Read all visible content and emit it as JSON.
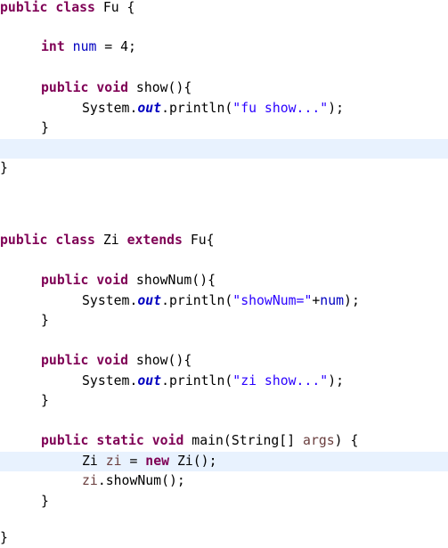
{
  "editor": {
    "language": "Java",
    "highlight_color": "#e8f2fe",
    "colors": {
      "keyword": "#7f0055",
      "field": "#0000c0",
      "string": "#2a00ff",
      "local_variable": "#6a3e3e",
      "plain": "#000000"
    },
    "lines": [
      {
        "indent": 0,
        "highlighted": false,
        "tokens": [
          {
            "t": "kw",
            "v": "public"
          },
          {
            "t": "p",
            "v": " "
          },
          {
            "t": "kw",
            "v": "class"
          },
          {
            "t": "p",
            "v": " Fu {"
          }
        ]
      },
      {
        "indent": 1,
        "highlighted": false,
        "tokens": [
          {
            "t": "kw",
            "v": "int"
          },
          {
            "t": "p",
            "v": " "
          },
          {
            "t": "field",
            "v": "num"
          },
          {
            "t": "p",
            "v": " = 4;"
          }
        ]
      },
      {
        "indent": 1,
        "highlighted": false,
        "tokens": [
          {
            "t": "kw",
            "v": "public"
          },
          {
            "t": "p",
            "v": " "
          },
          {
            "t": "kw",
            "v": "void"
          },
          {
            "t": "p",
            "v": " show(){"
          }
        ]
      },
      {
        "indent": 2,
        "highlighted": false,
        "tokens": [
          {
            "t": "p",
            "v": "System."
          },
          {
            "t": "sfield",
            "v": "out"
          },
          {
            "t": "p",
            "v": ".println("
          },
          {
            "t": "str",
            "v": "\"fu show...\""
          },
          {
            "t": "p",
            "v": ");"
          }
        ]
      },
      {
        "indent": 1,
        "highlighted": false,
        "tokens": [
          {
            "t": "p",
            "v": "}"
          }
        ]
      },
      {
        "indent": 0,
        "highlighted": true,
        "tokens": []
      },
      {
        "indent": 0,
        "highlighted": false,
        "tokens": [
          {
            "t": "p",
            "v": "}"
          }
        ]
      },
      {
        "indent": 0,
        "highlighted": false,
        "tokens": [
          {
            "t": "kw",
            "v": "public"
          },
          {
            "t": "p",
            "v": " "
          },
          {
            "t": "kw",
            "v": "class"
          },
          {
            "t": "p",
            "v": " Zi "
          },
          {
            "t": "kw",
            "v": "extends"
          },
          {
            "t": "p",
            "v": " Fu{"
          }
        ]
      },
      {
        "indent": 1,
        "highlighted": false,
        "tokens": [
          {
            "t": "kw",
            "v": "public"
          },
          {
            "t": "p",
            "v": " "
          },
          {
            "t": "kw",
            "v": "void"
          },
          {
            "t": "p",
            "v": " showNum(){"
          }
        ]
      },
      {
        "indent": 2,
        "highlighted": false,
        "tokens": [
          {
            "t": "p",
            "v": "System."
          },
          {
            "t": "sfield",
            "v": "out"
          },
          {
            "t": "p",
            "v": ".println("
          },
          {
            "t": "str",
            "v": "\"showNum=\""
          },
          {
            "t": "p",
            "v": "+"
          },
          {
            "t": "field",
            "v": "num"
          },
          {
            "t": "p",
            "v": ");"
          }
        ]
      },
      {
        "indent": 1,
        "highlighted": false,
        "tokens": [
          {
            "t": "p",
            "v": "}"
          }
        ]
      },
      {
        "indent": 1,
        "highlighted": false,
        "tokens": [
          {
            "t": "kw",
            "v": "public"
          },
          {
            "t": "p",
            "v": " "
          },
          {
            "t": "kw",
            "v": "void"
          },
          {
            "t": "p",
            "v": " show(){"
          }
        ]
      },
      {
        "indent": 2,
        "highlighted": false,
        "tokens": [
          {
            "t": "p",
            "v": "System."
          },
          {
            "t": "sfield",
            "v": "out"
          },
          {
            "t": "p",
            "v": ".println("
          },
          {
            "t": "str",
            "v": "\"zi show...\""
          },
          {
            "t": "p",
            "v": ");"
          }
        ]
      },
      {
        "indent": 1,
        "highlighted": false,
        "tokens": [
          {
            "t": "p",
            "v": "}"
          }
        ]
      },
      {
        "indent": 1,
        "highlighted": false,
        "tokens": [
          {
            "t": "kw",
            "v": "public"
          },
          {
            "t": "p",
            "v": " "
          },
          {
            "t": "kw",
            "v": "static"
          },
          {
            "t": "p",
            "v": " "
          },
          {
            "t": "kw",
            "v": "void"
          },
          {
            "t": "p",
            "v": " main(String[] "
          },
          {
            "t": "local",
            "v": "args"
          },
          {
            "t": "p",
            "v": ") {"
          }
        ]
      },
      {
        "indent": 2,
        "highlighted": true,
        "tokens": [
          {
            "t": "p",
            "v": "Zi "
          },
          {
            "t": "local",
            "v": "zi"
          },
          {
            "t": "p",
            "v": " = "
          },
          {
            "t": "kw",
            "v": "new"
          },
          {
            "t": "p",
            "v": " Zi();"
          }
        ]
      },
      {
        "indent": 2,
        "highlighted": false,
        "tokens": [
          {
            "t": "local",
            "v": "zi"
          },
          {
            "t": "p",
            "v": ".showNum();"
          }
        ]
      },
      {
        "indent": 1,
        "highlighted": false,
        "tokens": [
          {
            "t": "p",
            "v": "}"
          }
        ]
      },
      {
        "indent": 0,
        "highlighted": false,
        "tokens": [
          {
            "t": "p",
            "v": "}"
          }
        ]
      }
    ]
  }
}
